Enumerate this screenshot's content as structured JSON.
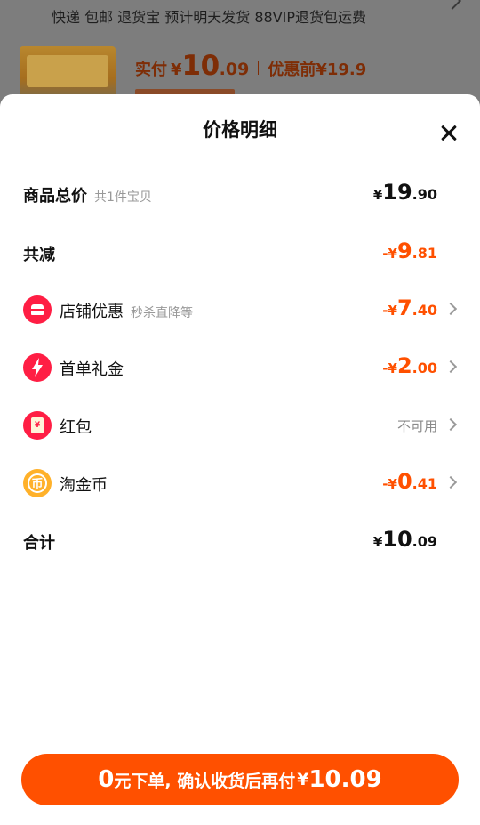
{
  "background": {
    "shipping_line": "快递 包邮 退货宝 预计明天发货 88VIP退货包运费",
    "paid_label": "实付",
    "currency": "¥",
    "paid_int": "10",
    "paid_dec": ".09",
    "pre_discount_label": "优惠前",
    "pre_discount_price": "¥19.9"
  },
  "sheet": {
    "title": "价格明细",
    "close_icon": "close-icon"
  },
  "rows": {
    "total": {
      "label": "商品总价",
      "sub": "共1件宝贝",
      "prefix": "¥",
      "int": "19",
      "dec": ".90"
    },
    "reduction": {
      "label": "共减",
      "prefix": "-¥",
      "int": "9",
      "dec": ".81"
    },
    "shop": {
      "icon": "store-icon",
      "label": "店铺优惠",
      "sub": "秒杀直降等",
      "prefix": "-¥",
      "int": "7",
      "dec": ".40"
    },
    "first_order": {
      "icon": "lightning-icon",
      "label": "首单礼金",
      "prefix": "-¥",
      "int": "2",
      "dec": ".00"
    },
    "red_packet": {
      "icon": "red-packet-icon",
      "label": "红包",
      "status": "不可用"
    },
    "coins": {
      "icon": "coin-icon",
      "label": "淘金币",
      "prefix": "-¥",
      "int": "0",
      "dec": ".41"
    },
    "sum": {
      "label": "合计",
      "prefix": "¥",
      "int": "10",
      "dec": ".09"
    }
  },
  "cta": {
    "zero": "0",
    "text": "元下单, 确认收货后再付",
    "currency": "¥",
    "amount": "10.09"
  },
  "colors": {
    "accent": "#ff5000",
    "badge_red": "#ff1e44",
    "coin_gold": "#ffb12a"
  }
}
